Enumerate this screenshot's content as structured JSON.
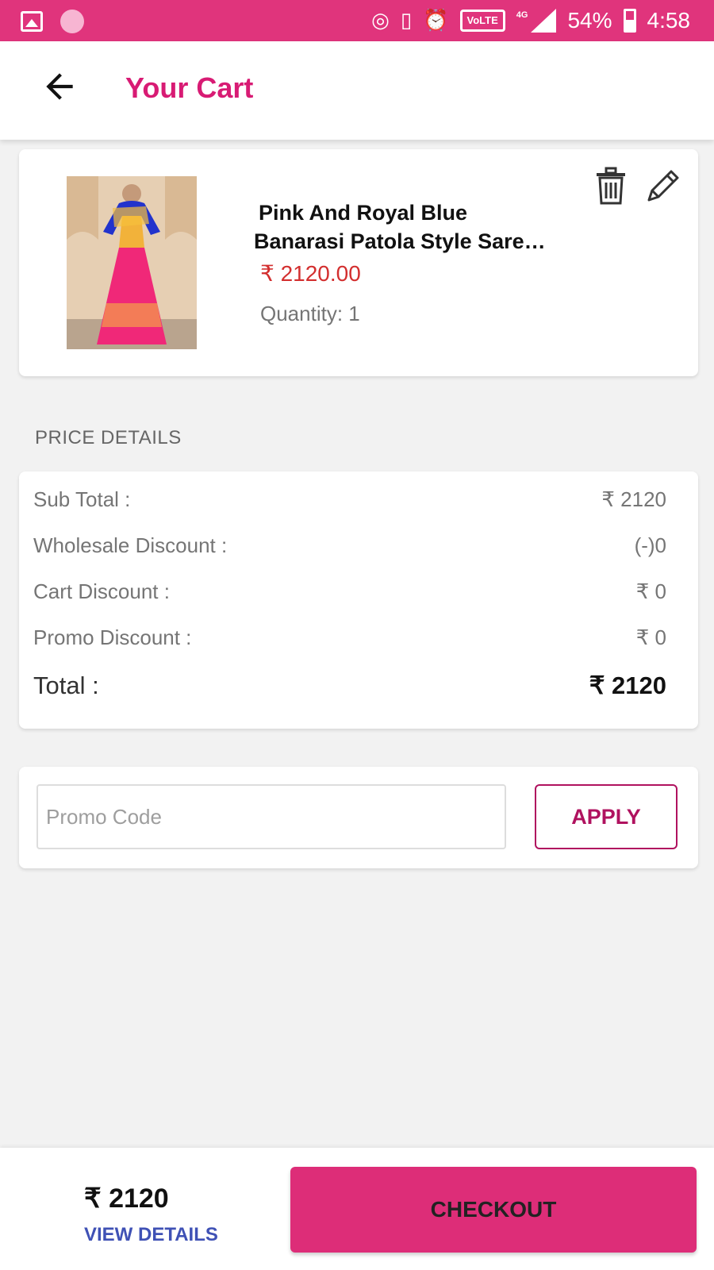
{
  "status_bar": {
    "battery": "54%",
    "time": "4:58",
    "network": "4G",
    "volte": "VoLTE"
  },
  "header": {
    "title": "Your Cart"
  },
  "cart_item": {
    "name_line1": "Pink And Royal Blue",
    "name_line2": "Banarasi Patola Style Sare…",
    "price": "₹ 2120.00",
    "quantity": "Quantity: 1"
  },
  "price_details": {
    "heading": "PRICE DETAILS",
    "rows": [
      {
        "label": "Sub Total :",
        "value": "₹ 2120"
      },
      {
        "label": "Wholesale Discount :",
        "value": "(-)0"
      },
      {
        "label": "Cart Discount :",
        "value": "₹ 0"
      },
      {
        "label": "Promo Discount :",
        "value": "₹ 0"
      }
    ],
    "total_label": "Total :",
    "total_value": "₹ 2120"
  },
  "promo": {
    "placeholder": "Promo Code",
    "value": "",
    "apply_label": "APPLY"
  },
  "footer": {
    "total": "₹ 2120",
    "view_details": "VIEW DETAILS",
    "checkout_label": "CHECKOUT"
  },
  "colors": {
    "brand": "#e0347c",
    "title": "#d81b74",
    "price": "#d32f2f",
    "link": "#3f51b5"
  }
}
